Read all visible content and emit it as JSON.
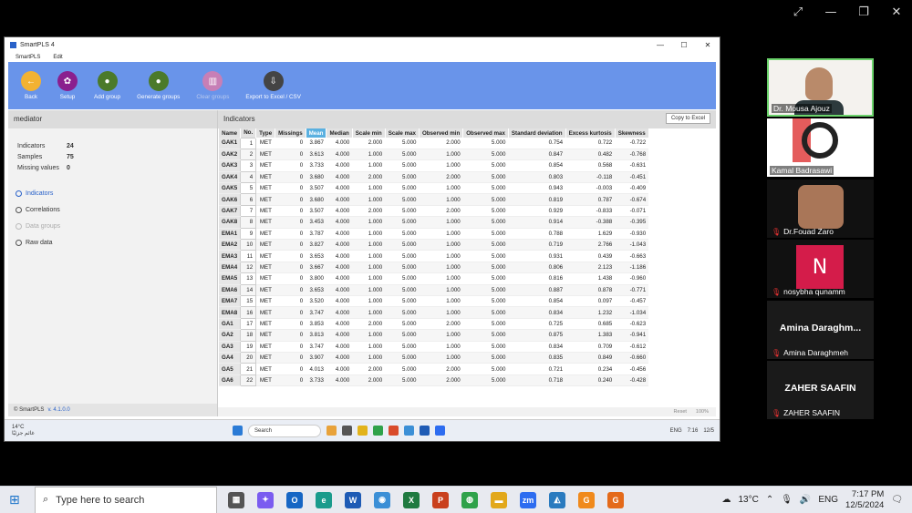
{
  "zoom_top": {
    "icons": [
      "fullscreen-icon",
      "minimize-icon",
      "restore-icon",
      "close-icon"
    ]
  },
  "app": {
    "title": "SmartPLS 4",
    "menu": [
      "SmartPLS",
      "Edit"
    ],
    "toolbar": [
      {
        "label": "Back",
        "icon": "back-icon",
        "color": "#f2b233",
        "enabled": true
      },
      {
        "label": "Setup",
        "icon": "gear-icon",
        "color": "#8a1f8e",
        "enabled": true
      },
      {
        "label": "Add group",
        "icon": "user-icon",
        "color": "#4b7a2a",
        "enabled": true
      },
      {
        "label": "Generate groups",
        "icon": "users-icon",
        "color": "#4b7a2a",
        "enabled": true
      },
      {
        "label": "Clear groups",
        "icon": "trash-icon",
        "color": "#c77fb6",
        "enabled": false
      },
      {
        "label": "Export to Excel / CSV",
        "icon": "export-icon",
        "color": "#444444",
        "enabled": true
      }
    ],
    "left_panel": {
      "title": "mediator",
      "stats": [
        {
          "label": "Indicators",
          "value": "24"
        },
        {
          "label": "Samples",
          "value": "75"
        },
        {
          "label": "Missing values",
          "value": "0"
        }
      ],
      "options": [
        {
          "label": "Indicators",
          "state": "selected"
        },
        {
          "label": "Correlations",
          "state": "normal"
        },
        {
          "label": "Data groups",
          "state": "disabled"
        },
        {
          "label": "Raw data",
          "state": "normal"
        }
      ],
      "footer_brand": "© SmartPLS",
      "footer_version": "v. 4.1.0.0"
    },
    "right_panel": {
      "title": "Indicators",
      "copy_label": "Copy to Excel",
      "columns": [
        "Name",
        "No.",
        "Type",
        "Missings",
        "Mean",
        "Median",
        "Scale min",
        "Scale max",
        "Observed min",
        "Observed max",
        "Standard deviation",
        "Excess kurtosis",
        "Skewness"
      ],
      "rows": [
        [
          "GAK1",
          "1",
          "MET",
          "0",
          "3.867",
          "4.000",
          "2.000",
          "5.000",
          "2.000",
          "5.000",
          "0.754",
          "0.722",
          "-0.722"
        ],
        [
          "GAK2",
          "2",
          "MET",
          "0",
          "3.613",
          "4.000",
          "1.000",
          "5.000",
          "1.000",
          "5.000",
          "0.847",
          "0.482",
          "-0.768"
        ],
        [
          "GAK3",
          "3",
          "MET",
          "0",
          "3.733",
          "4.000",
          "1.000",
          "5.000",
          "1.000",
          "5.000",
          "0.854",
          "0.568",
          "-0.631"
        ],
        [
          "GAK4",
          "4",
          "MET",
          "0",
          "3.680",
          "4.000",
          "2.000",
          "5.000",
          "2.000",
          "5.000",
          "0.803",
          "-0.118",
          "-0.451"
        ],
        [
          "GAK5",
          "5",
          "MET",
          "0",
          "3.507",
          "4.000",
          "1.000",
          "5.000",
          "1.000",
          "5.000",
          "0.943",
          "-0.003",
          "-0.409"
        ],
        [
          "GAK6",
          "6",
          "MET",
          "0",
          "3.680",
          "4.000",
          "1.000",
          "5.000",
          "1.000",
          "5.000",
          "0.819",
          "0.787",
          "-0.674"
        ],
        [
          "GAK7",
          "7",
          "MET",
          "0",
          "3.507",
          "4.000",
          "2.000",
          "5.000",
          "2.000",
          "5.000",
          "0.929",
          "-0.833",
          "-0.071"
        ],
        [
          "GAK8",
          "8",
          "MET",
          "0",
          "3.453",
          "4.000",
          "1.000",
          "5.000",
          "1.000",
          "5.000",
          "0.914",
          "-0.388",
          "-0.395"
        ],
        [
          "EMA1",
          "9",
          "MET",
          "0",
          "3.787",
          "4.000",
          "1.000",
          "5.000",
          "1.000",
          "5.000",
          "0.788",
          "1.629",
          "-0.930"
        ],
        [
          "EMA2",
          "10",
          "MET",
          "0",
          "3.827",
          "4.000",
          "1.000",
          "5.000",
          "1.000",
          "5.000",
          "0.719",
          "2.766",
          "-1.043"
        ],
        [
          "EMA3",
          "11",
          "MET",
          "0",
          "3.653",
          "4.000",
          "1.000",
          "5.000",
          "1.000",
          "5.000",
          "0.931",
          "0.439",
          "-0.663"
        ],
        [
          "EMA4",
          "12",
          "MET",
          "0",
          "3.667",
          "4.000",
          "1.000",
          "5.000",
          "1.000",
          "5.000",
          "0.806",
          "2.123",
          "-1.186"
        ],
        [
          "EMA5",
          "13",
          "MET",
          "0",
          "3.800",
          "4.000",
          "1.000",
          "5.000",
          "1.000",
          "5.000",
          "0.816",
          "1.438",
          "-0.960"
        ],
        [
          "EMA6",
          "14",
          "MET",
          "0",
          "3.653",
          "4.000",
          "1.000",
          "5.000",
          "1.000",
          "5.000",
          "0.887",
          "0.878",
          "-0.771"
        ],
        [
          "EMA7",
          "15",
          "MET",
          "0",
          "3.520",
          "4.000",
          "1.000",
          "5.000",
          "1.000",
          "5.000",
          "0.854",
          "0.097",
          "-0.457"
        ],
        [
          "EMA8",
          "16",
          "MET",
          "0",
          "3.747",
          "4.000",
          "1.000",
          "5.000",
          "1.000",
          "5.000",
          "0.834",
          "1.232",
          "-1.034"
        ],
        [
          "GA1",
          "17",
          "MET",
          "0",
          "3.853",
          "4.000",
          "2.000",
          "5.000",
          "2.000",
          "5.000",
          "0.725",
          "0.685",
          "-0.623"
        ],
        [
          "GA2",
          "18",
          "MET",
          "0",
          "3.813",
          "4.000",
          "1.000",
          "5.000",
          "1.000",
          "5.000",
          "0.875",
          "1.383",
          "-0.941"
        ],
        [
          "GA3",
          "19",
          "MET",
          "0",
          "3.747",
          "4.000",
          "1.000",
          "5.000",
          "1.000",
          "5.000",
          "0.834",
          "0.709",
          "-0.612"
        ],
        [
          "GA4",
          "20",
          "MET",
          "0",
          "3.907",
          "4.000",
          "1.000",
          "5.000",
          "1.000",
          "5.000",
          "0.835",
          "0.849",
          "-0.660"
        ],
        [
          "GA5",
          "21",
          "MET",
          "0",
          "4.013",
          "4.000",
          "2.000",
          "5.000",
          "2.000",
          "5.000",
          "0.721",
          "0.234",
          "-0.456"
        ],
        [
          "GA6",
          "22",
          "MET",
          "0",
          "3.733",
          "4.000",
          "2.000",
          "5.000",
          "2.000",
          "5.000",
          "0.718",
          "0.240",
          "-0.428"
        ]
      ],
      "footer_reset": "Reset",
      "footer_zoom": "100%"
    }
  },
  "shared_taskbar": {
    "weather_temp": "14°C",
    "weather_desc": "غائم جزئيًا",
    "search": "Search",
    "lang": "ENG",
    "time": "7:16",
    "date": "12/5"
  },
  "participants": [
    {
      "name": "Dr. Mousa Ajouz",
      "muted": false
    },
    {
      "name": "Kamal Badrasawi",
      "muted": false
    },
    {
      "name": "Dr.Fouad Zaro",
      "muted": true
    },
    {
      "name": "nosybha qunamm",
      "muted": true,
      "avatar": "N"
    },
    {
      "display": "Amina Daraghm...",
      "name": "Amina Daraghmeh",
      "muted": true
    },
    {
      "display": "ZAHER SAAFIN",
      "name": "ZAHER SAAFIN",
      "muted": true
    }
  ],
  "taskbar": {
    "search_placeholder": "Type here to search",
    "weather": "13°C",
    "lang": "ENG",
    "time": "7:17 PM",
    "date": "12/5/2024",
    "apps": [
      {
        "name": "task-view-icon",
        "color": "#555555",
        "glyph": "▦"
      },
      {
        "name": "copilot-icon",
        "color": "#7a5cf0",
        "glyph": "✦"
      },
      {
        "name": "outlook-icon",
        "color": "#1666c4",
        "glyph": "O"
      },
      {
        "name": "edge-icon",
        "color": "#1a9b8c",
        "glyph": "e"
      },
      {
        "name": "word-icon",
        "color": "#1e5bb5",
        "glyph": "W"
      },
      {
        "name": "photos-icon",
        "color": "#3b8fd6",
        "glyph": "◉"
      },
      {
        "name": "excel-icon",
        "color": "#1f7a40",
        "glyph": "X"
      },
      {
        "name": "powerpoint-icon",
        "color": "#c9401d",
        "glyph": "P"
      },
      {
        "name": "chrome-icon",
        "color": "#2fa24a",
        "glyph": "◍"
      },
      {
        "name": "explorer-icon",
        "color": "#e2a81b",
        "glyph": "▬"
      },
      {
        "name": "zoom-icon",
        "color": "#2d6cf0",
        "glyph": "zm"
      },
      {
        "name": "photo-editor-icon",
        "color": "#2a7bbf",
        "glyph": "◭"
      },
      {
        "name": "smartpls-icon",
        "color": "#f08a1c",
        "glyph": "G"
      },
      {
        "name": "smartpls-active-icon",
        "color": "#e46a1a",
        "glyph": "G"
      }
    ]
  }
}
